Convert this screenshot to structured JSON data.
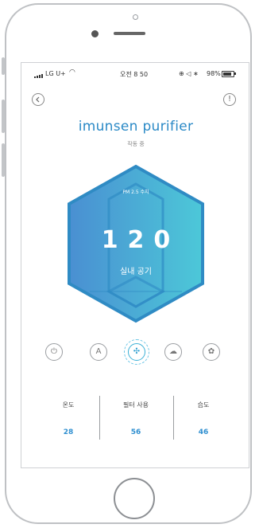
{
  "status_bar": {
    "carrier": "LG U+",
    "time": "오전 8 50",
    "status_icons": "⊕ ◁ ∗",
    "battery": "98%"
  },
  "header": {
    "back_icon": "chevron-left-icon",
    "info_icon": "exclamation-icon",
    "info_symbol": "!"
  },
  "device": {
    "title": "imunsen purifier",
    "subtitle": "작동 중"
  },
  "air": {
    "pm_label": "PM 2.5 수치",
    "value": "120",
    "label": "실내 공기"
  },
  "controls": [
    {
      "name": "power-icon",
      "symbol": "⏻",
      "active": false
    },
    {
      "name": "auto-mode-icon",
      "symbol": "A",
      "active": false
    },
    {
      "name": "fan-icon",
      "symbol": "✣",
      "active": true
    },
    {
      "name": "sleep-mode-icon",
      "symbol": "☁",
      "active": false
    },
    {
      "name": "filter-icon",
      "symbol": "✿",
      "active": false
    }
  ],
  "stats": [
    {
      "label": "온도",
      "value": "28"
    },
    {
      "label": "필터 사용",
      "value": "56"
    },
    {
      "label": "습도",
      "value": "46"
    }
  ],
  "colors": {
    "accent": "#2a89c6",
    "hex_start": "#3f86cc",
    "hex_end": "#45c3d6",
    "value": "#2f8fd0"
  }
}
